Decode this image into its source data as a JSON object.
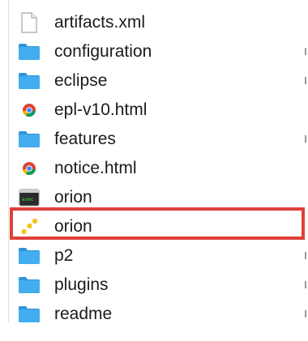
{
  "files": [
    {
      "name": "artifacts.xml",
      "icon": "document-icon",
      "tick": false
    },
    {
      "name": "configuration",
      "icon": "folder-icon",
      "tick": true
    },
    {
      "name": "eclipse",
      "icon": "folder-icon",
      "tick": true
    },
    {
      "name": "epl-v10.html",
      "icon": "chrome-html-icon",
      "tick": false
    },
    {
      "name": "features",
      "icon": "folder-icon",
      "tick": true
    },
    {
      "name": "notice.html",
      "icon": "chrome-html-icon",
      "tick": false
    },
    {
      "name": "orion",
      "icon": "terminal-executable-icon",
      "tick": false
    },
    {
      "name": "orion",
      "icon": "orion-app-icon",
      "tick": false,
      "highlighted": true
    },
    {
      "name": "p2",
      "icon": "folder-icon",
      "tick": true
    },
    {
      "name": "plugins",
      "icon": "folder-icon",
      "tick": true
    },
    {
      "name": "readme",
      "icon": "folder-icon",
      "tick": true
    }
  ],
  "colors": {
    "folder": "#3aa6e6",
    "highlight": "#e0403a",
    "text": "#1b1b1b"
  }
}
